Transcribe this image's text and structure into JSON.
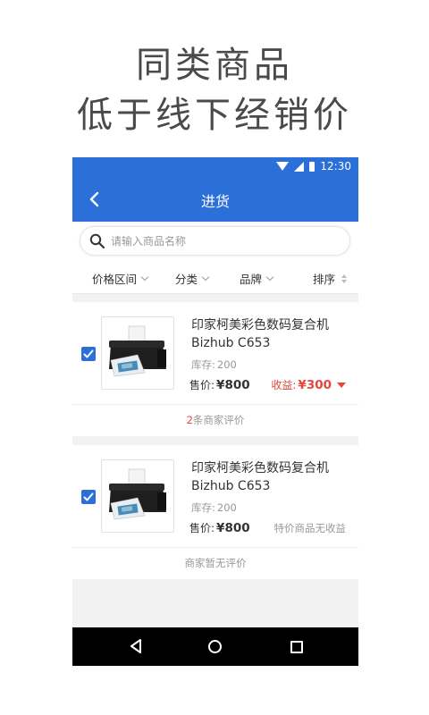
{
  "promo": {
    "line1": "同类商品",
    "line2": "低于线下经销价"
  },
  "status_bar": {
    "time": "12:30"
  },
  "app_bar": {
    "title": "进货"
  },
  "search": {
    "placeholder": "请输入商品名称",
    "value": ""
  },
  "filters": [
    {
      "label": "价格区间"
    },
    {
      "label": "分类"
    },
    {
      "label": "品牌"
    },
    {
      "label": "排序"
    }
  ],
  "products": [
    {
      "checked": true,
      "name": "印家柯美彩色数码复合机 Bizhub C653",
      "stock_label": "库存:",
      "stock_value": "200",
      "price_label": "售价:",
      "price_value": "¥800",
      "earnings_label": "收益:",
      "earnings_value": "¥300",
      "review_count": "2",
      "review_text": "条商家评价"
    },
    {
      "checked": true,
      "name": "印家柯美彩色数码复合机 Bizhub C653",
      "stock_label": "库存:",
      "stock_value": "200",
      "price_label": "售价:",
      "price_value": "¥800",
      "no_earnings_text": "特价商品无收益",
      "review_text": "商家暂无评价"
    }
  ],
  "colors": {
    "primary": "#2b6fd9",
    "accent_red": "#e6463a",
    "background": "#f2f2f2"
  },
  "icons": [
    "back-arrow-icon",
    "search-icon",
    "wifi-icon",
    "signal-icon",
    "battery-icon",
    "checkbox-checked-icon",
    "printer-icon",
    "nav-back-icon",
    "nav-home-icon",
    "nav-recent-icon"
  ]
}
